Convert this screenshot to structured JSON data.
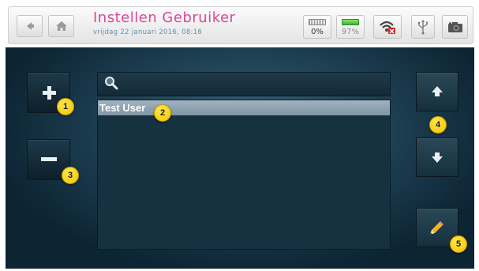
{
  "header": {
    "title": "Instellen Gebruiker",
    "datetime": "vrijdag 22 januari 2016, 08:16",
    "battery_left": {
      "percent_label": "0%",
      "level": 0
    },
    "battery_right": {
      "percent_label": "97%",
      "level": 0.97
    },
    "icons": [
      "back-arrow-icon",
      "home-icon",
      "wifi-error-icon",
      "usb-icon",
      "camera-icon"
    ]
  },
  "toolbar": {
    "add_icon": "plus-icon",
    "remove_icon": "minus-icon",
    "up_icon": "arrow-up-icon",
    "down_icon": "arrow-down-icon",
    "edit_icon": "pencil-icon"
  },
  "search": {
    "value": "",
    "icon": "search-icon"
  },
  "users": [
    {
      "name": "Test User",
      "selected": true
    }
  ],
  "markers": [
    "1",
    "2",
    "3",
    "4",
    "5"
  ],
  "colors": {
    "title": "#d9489a",
    "subtitle": "#5f8fb0",
    "selection": "#8fa4b4",
    "marker": "#f5c800",
    "background": "#1f4356"
  }
}
